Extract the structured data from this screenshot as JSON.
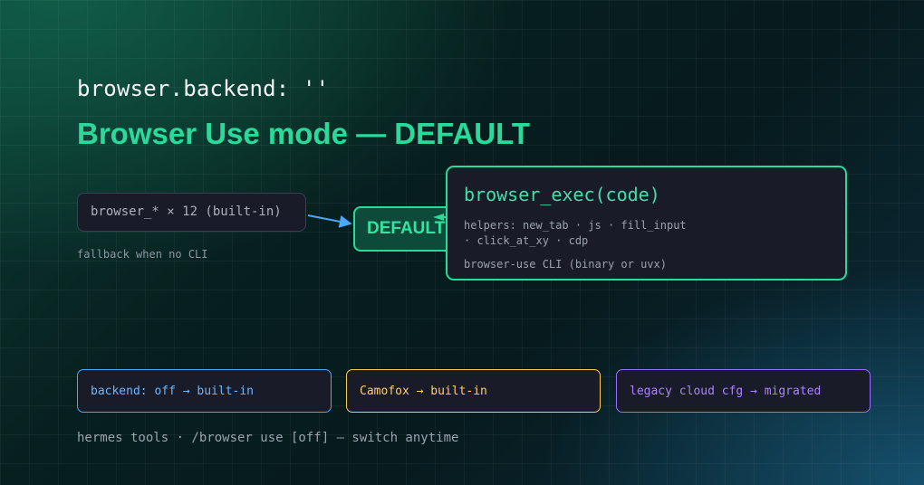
{
  "header": {
    "config_key": "browser.backend: ''",
    "title": "Browser Use mode — DEFAULT"
  },
  "fallback": {
    "label": "browser_* × 12 (built-in)",
    "note": "fallback when no CLI"
  },
  "badge": {
    "label": "DEFAULT"
  },
  "exec_card": {
    "title": "browser_exec(code)",
    "helpers": "helpers: new_tab · js · fill_input · click_at_xy · cdp",
    "cli": "browser-use CLI (binary or uvx)"
  },
  "status_cards": [
    {
      "label": "backend: off → built-in",
      "color": "#4aa8ff"
    },
    {
      "label": "Camofox → built-in",
      "color": "#ffcb52"
    },
    {
      "label": "legacy cloud cfg → migrated",
      "color": "#9a6cff"
    }
  ],
  "footer": {
    "text": "hermes tools · /browser use [off] — switch anytime"
  },
  "colors": {
    "accent_green": "#2bd99a",
    "arrow_blue": "#4aa8ff",
    "card_bg": "#1a1b29"
  }
}
